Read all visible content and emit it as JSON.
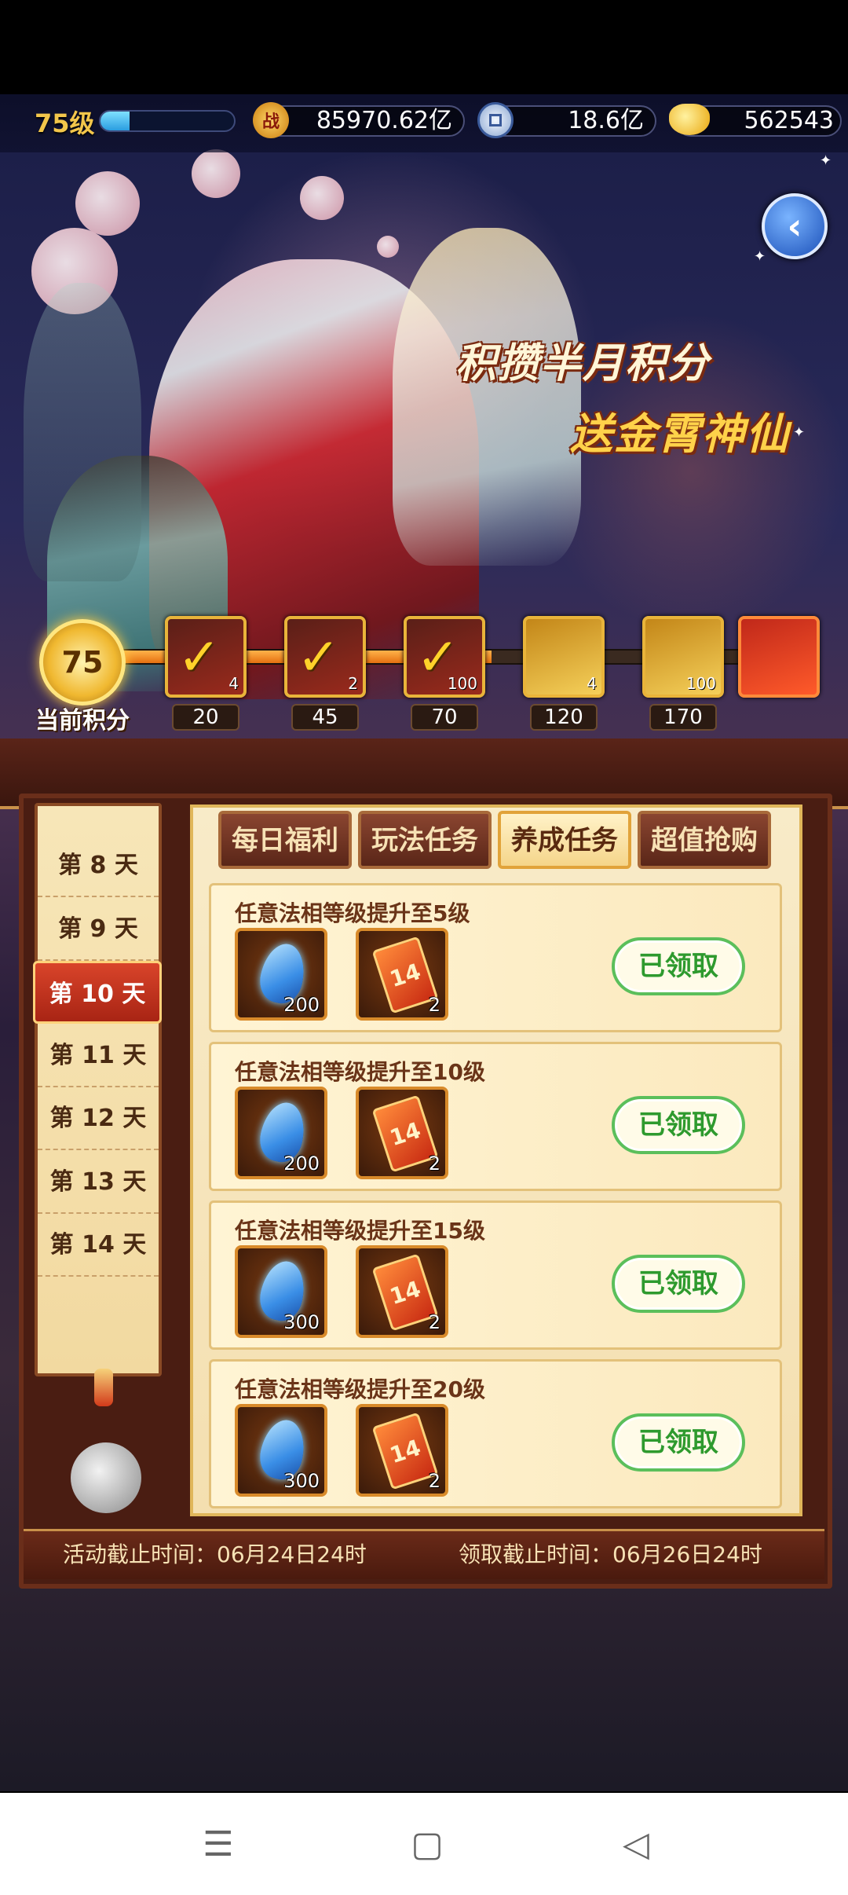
{
  "header": {
    "level": "75级",
    "xp_fraction": 0.22,
    "power_icon_label": "战",
    "power": "85970.62亿",
    "coins": "18.6亿",
    "gold": "562543"
  },
  "banner": {
    "line1": "积攒半月积分",
    "line2": "送金霄神仙"
  },
  "score": {
    "current": "75",
    "label": "当前积分",
    "fill_fraction": 0.55,
    "milestones": [
      {
        "points": "20",
        "count": "4",
        "claimed": true,
        "style": "dark"
      },
      {
        "points": "45",
        "count": "2",
        "claimed": true,
        "style": "dark"
      },
      {
        "points": "70",
        "count": "100",
        "claimed": true,
        "style": "dark"
      },
      {
        "points": "120",
        "count": "4",
        "claimed": false,
        "style": "gold"
      },
      {
        "points": "170",
        "count": "100",
        "claimed": false,
        "style": "gold"
      },
      {
        "points": "",
        "count": "",
        "claimed": false,
        "style": "red"
      }
    ]
  },
  "days": [
    "第 8 天",
    "第 9 天",
    "第 10 天",
    "第 11 天",
    "第 12 天",
    "第 13 天",
    "第 14 天"
  ],
  "active_day": "第 10 天",
  "tabs": [
    "每日福利",
    "玩法任务",
    "养成任务",
    "超值抢购"
  ],
  "active_tab": "养成任务",
  "tasks": [
    {
      "title": "任意法相等级提升至5级",
      "rewards": [
        {
          "icon": "blue-crystal-icon",
          "qty": "200"
        },
        {
          "icon": "ticket-icon",
          "qty": "2"
        }
      ],
      "status": "已领取"
    },
    {
      "title": "任意法相等级提升至10级",
      "rewards": [
        {
          "icon": "blue-crystal-icon",
          "qty": "200"
        },
        {
          "icon": "ticket-icon",
          "qty": "2"
        }
      ],
      "status": "已领取"
    },
    {
      "title": "任意法相等级提升至15级",
      "rewards": [
        {
          "icon": "blue-crystal-icon",
          "qty": "300"
        },
        {
          "icon": "ticket-icon",
          "qty": "2"
        }
      ],
      "status": "已领取"
    },
    {
      "title": "任意法相等级提升至20级",
      "rewards": [
        {
          "icon": "blue-crystal-icon",
          "qty": "300"
        },
        {
          "icon": "ticket-icon",
          "qty": "2"
        }
      ],
      "status": "已领取"
    }
  ],
  "ticket_label": "14",
  "footer": {
    "event_end": "活动截止时间：06月24日24时",
    "claim_end": "领取截止时间：06月26日24时"
  },
  "back_glyph": "‹",
  "nav": {
    "menu": "☰",
    "home": "▢",
    "back": "◁"
  }
}
